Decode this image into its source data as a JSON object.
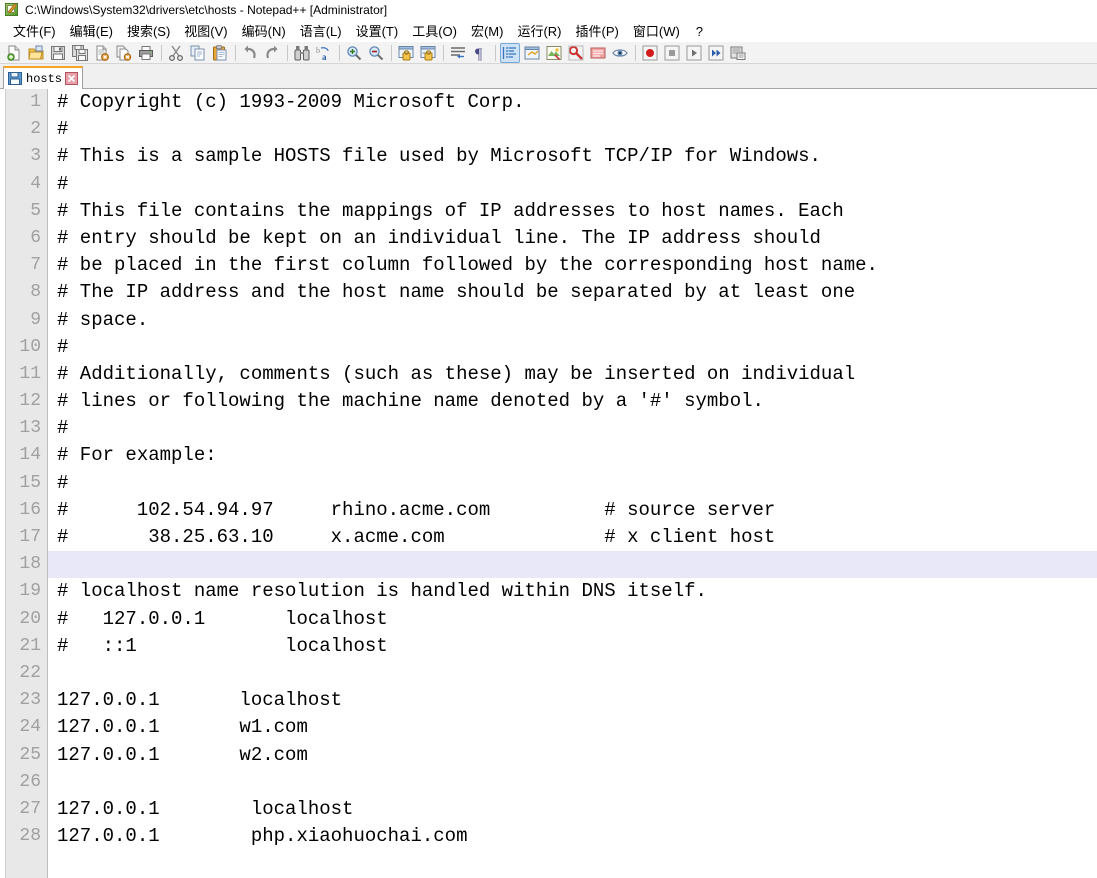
{
  "window": {
    "title": "C:\\Windows\\System32\\drivers\\etc\\hosts - Notepad++ [Administrator]",
    "app_icon": "notepad-plus-plus-icon"
  },
  "menubar": {
    "items": [
      {
        "label": "文件(F)",
        "name": "menu-file"
      },
      {
        "label": "编辑(E)",
        "name": "menu-edit"
      },
      {
        "label": "搜索(S)",
        "name": "menu-search"
      },
      {
        "label": "视图(V)",
        "name": "menu-view"
      },
      {
        "label": "编码(N)",
        "name": "menu-encoding"
      },
      {
        "label": "语言(L)",
        "name": "menu-language"
      },
      {
        "label": "设置(T)",
        "name": "menu-settings"
      },
      {
        "label": "工具(O)",
        "name": "menu-tools"
      },
      {
        "label": "宏(M)",
        "name": "menu-macro"
      },
      {
        "label": "运行(R)",
        "name": "menu-run"
      },
      {
        "label": "插件(P)",
        "name": "menu-plugins"
      },
      {
        "label": "窗口(W)",
        "name": "menu-window"
      },
      {
        "label": "?",
        "name": "menu-help"
      }
    ]
  },
  "toolbar": {
    "icons": [
      "new-file-icon",
      "open-file-icon",
      "save-icon",
      "save-all-icon",
      "close-file-icon",
      "close-all-icon",
      "print-icon",
      "cut-icon",
      "copy-icon",
      "paste-icon",
      "undo-icon",
      "redo-icon",
      "find-icon",
      "replace-icon",
      "zoom-in-icon",
      "zoom-out-icon",
      "sync-vertical-scroll-icon",
      "sync-horizontal-scroll-icon",
      "word-wrap-icon",
      "show-all-characters-icon",
      "indent-guide-icon",
      "ui-zoom-icon",
      "user-defined-language-icon",
      "document-map-icon",
      "function-list-icon",
      "document-switcher-icon",
      "macro-record-icon",
      "macro-stop-icon",
      "macro-play-icon",
      "macro-run-multiple-icon",
      "macro-save-icon"
    ],
    "active_icon": "indent-guide-icon"
  },
  "tabs": [
    {
      "label": "hosts",
      "name": "tab-hosts",
      "icon": "saved-file-icon",
      "close": "close-tab-icon",
      "active": true
    }
  ],
  "editor": {
    "current_line": 18,
    "colors": {
      "gutter_bg": "#e8e8e8",
      "line_number": "#a0a0a0",
      "current_line_highlight": "#e8e8f8",
      "text": "#000000",
      "tab_accent": "#f5a623"
    },
    "lines": [
      {
        "n": 1,
        "text": "# Copyright (c) 1993-2009 Microsoft Corp."
      },
      {
        "n": 2,
        "text": "#"
      },
      {
        "n": 3,
        "text": "# This is a sample HOSTS file used by Microsoft TCP/IP for Windows."
      },
      {
        "n": 4,
        "text": "#"
      },
      {
        "n": 5,
        "text": "# This file contains the mappings of IP addresses to host names. Each"
      },
      {
        "n": 6,
        "text": "# entry should be kept on an individual line. The IP address should"
      },
      {
        "n": 7,
        "text": "# be placed in the first column followed by the corresponding host name."
      },
      {
        "n": 8,
        "text": "# The IP address and the host name should be separated by at least one"
      },
      {
        "n": 9,
        "text": "# space."
      },
      {
        "n": 10,
        "text": "#"
      },
      {
        "n": 11,
        "text": "# Additionally, comments (such as these) may be inserted on individual"
      },
      {
        "n": 12,
        "text": "# lines or following the machine name denoted by a '#' symbol."
      },
      {
        "n": 13,
        "text": "#"
      },
      {
        "n": 14,
        "text": "# For example:"
      },
      {
        "n": 15,
        "text": "#"
      },
      {
        "n": 16,
        "text": "#      102.54.94.97     rhino.acme.com          # source server"
      },
      {
        "n": 17,
        "text": "#       38.25.63.10     x.acme.com              # x client host"
      },
      {
        "n": 18,
        "text": ""
      },
      {
        "n": 19,
        "text": "# localhost name resolution is handled within DNS itself."
      },
      {
        "n": 20,
        "text": "#   127.0.0.1       localhost"
      },
      {
        "n": 21,
        "text": "#   ::1             localhost"
      },
      {
        "n": 22,
        "text": ""
      },
      {
        "n": 23,
        "text": "127.0.0.1       localhost"
      },
      {
        "n": 24,
        "text": "127.0.0.1       w1.com"
      },
      {
        "n": 25,
        "text": "127.0.0.1       w2.com"
      },
      {
        "n": 26,
        "text": ""
      },
      {
        "n": 27,
        "text": "127.0.0.1        localhost"
      },
      {
        "n": 28,
        "text": "127.0.0.1        php.xiaohuochai.com"
      }
    ]
  }
}
